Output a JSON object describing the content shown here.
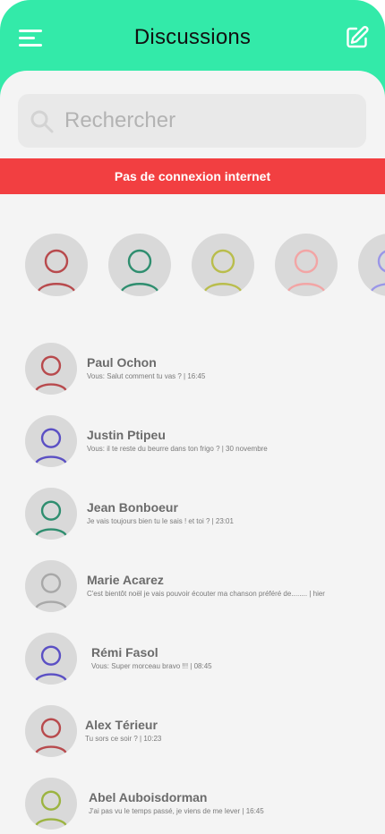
{
  "header": {
    "title": "Discussions",
    "menu_icon": "hamburger-menu-icon",
    "compose_icon": "edit-compose-icon",
    "background": "#33eaa9"
  },
  "search": {
    "placeholder": "Rechercher",
    "value": "",
    "icon": "search-icon"
  },
  "banner": {
    "text": "Pas de connexion internet",
    "color": "#f23f41"
  },
  "stories": [
    {
      "color": "#b84a4d"
    },
    {
      "color": "#2f8e6f"
    },
    {
      "color": "#b9bd4c"
    },
    {
      "color": "#f2a5a5"
    },
    {
      "color": "#9a96e8"
    }
  ],
  "conversations": [
    {
      "name": "Paul Ochon",
      "preview": "Vous: Salut comment tu vas ? | 16:45",
      "color": "#b84a4d"
    },
    {
      "name": "Justin Ptipeu",
      "preview": "Vous: il te reste du beurre dans ton frigo ? | 30 novembre",
      "color": "#5b50c4"
    },
    {
      "name": "Jean Bonboeur",
      "preview": "Je vais toujours bien tu le sais ! et toi ? | 23:01",
      "color": "#2f8e6f"
    },
    {
      "name": "Marie Acarez",
      "preview": "C'est bientôt noël je vais pouvoir écouter ma chanson préféré de........ | hier",
      "color": "#a8a8a8"
    },
    {
      "name": "Rémi Fasol",
      "preview": "Vous: Super morceau bravo !!! | 08:45",
      "color": "#5b50c4"
    },
    {
      "name": "Alex Térieur",
      "preview": "Tu sors ce soir ? | 10:23",
      "color": "#b84a4d"
    },
    {
      "name": "Abel Auboisdorman",
      "preview": "J'ai pas vu le temps passé, je viens de me lever | 16:45",
      "color": "#9cb441"
    }
  ]
}
